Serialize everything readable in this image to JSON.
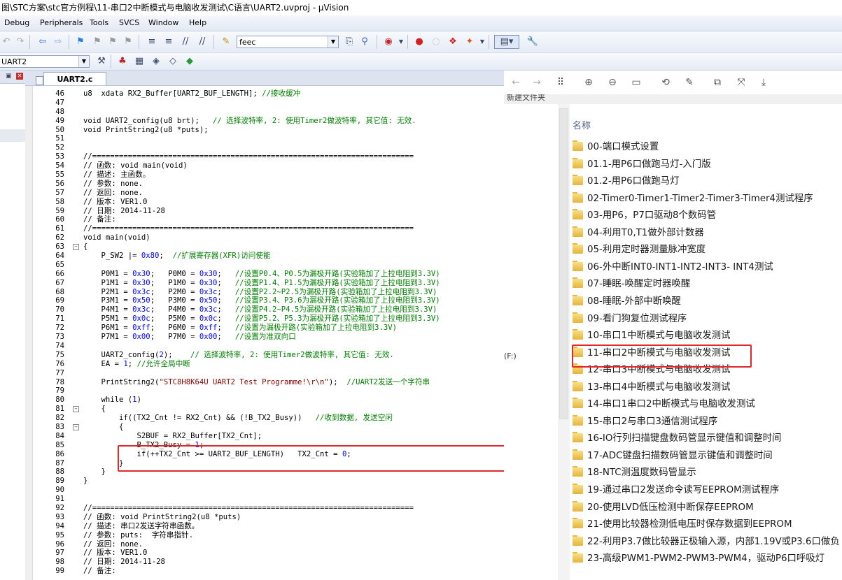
{
  "window": {
    "title": "图\\STC方案\\stc官方例程\\11-串口2中断模式与电脑收发测试\\C语言\\UART2.uvproj - µVision"
  },
  "menu": [
    "Debug",
    "Peripherals",
    "Tools",
    "SVCS",
    "Window",
    "Help"
  ],
  "toolbar": {
    "find_combo": "feec",
    "target_combo": "UART2"
  },
  "editor": {
    "tab_label": "UART2.c",
    "lines": [
      {
        "n": "46",
        "t": "u8  xdata RX2_Buffer[UART2_BUF_LENGTH]; //接收缓冲"
      },
      {
        "n": "47",
        "t": ""
      },
      {
        "n": "48",
        "t": ""
      },
      {
        "n": "49",
        "t": "void UART2_config(u8 brt);   // 选择波特率, 2: 使用Timer2做波特率, 其它值: 无效."
      },
      {
        "n": "50",
        "t": "void PrintString2(u8 *puts);"
      },
      {
        "n": "51",
        "t": ""
      },
      {
        "n": "52",
        "t": ""
      },
      {
        "n": "53",
        "t": "//========================================================================"
      },
      {
        "n": "54",
        "t": "// 函数: void main(void)"
      },
      {
        "n": "55",
        "t": "// 描述: 主函数。"
      },
      {
        "n": "56",
        "t": "// 参数: none."
      },
      {
        "n": "57",
        "t": "// 返回: none."
      },
      {
        "n": "58",
        "t": "// 版本: VER1.0"
      },
      {
        "n": "59",
        "t": "// 日期: 2014-11-28"
      },
      {
        "n": "60",
        "t": "// 备注:"
      },
      {
        "n": "61",
        "t": "//========================================================================"
      },
      {
        "n": "62",
        "t": "void main(void)"
      },
      {
        "n": "63",
        "t": "{"
      },
      {
        "n": "64",
        "t": "    P_SW2 |= 0x80;  //扩展寄存器(XFR)访问使能"
      },
      {
        "n": "65",
        "t": ""
      },
      {
        "n": "66",
        "t": "    P0M1 = 0x30;   P0M0 = 0x30;   //设置P0.4、P0.5为漏极开路(实验箱加了上拉电阻到3.3V)"
      },
      {
        "n": "67",
        "t": "    P1M1 = 0x30;   P1M0 = 0x30;   //设置P1.4、P1.5为漏极开路(实验箱加了上拉电阻到3.3V)"
      },
      {
        "n": "68",
        "t": "    P2M1 = 0x3c;   P2M0 = 0x3c;   //设置P2.2~P2.5为漏极开路(实验箱加了上拉电阻到3.3V)"
      },
      {
        "n": "69",
        "t": "    P3M1 = 0x50;   P3M0 = 0x50;   //设置P3.4、P3.6为漏极开路(实验箱加了上拉电阻到3.3V)"
      },
      {
        "n": "70",
        "t": "    P4M1 = 0x3c;   P4M0 = 0x3c;   //设置P4.2~P4.5为漏极开路(实验箱加了上拉电阻到3.3V)"
      },
      {
        "n": "71",
        "t": "    P5M1 = 0x0c;   P5M0 = 0x0c;   //设置P5.2、P5.3为漏极开路(实验箱加了上拉电阻到3.3V)"
      },
      {
        "n": "72",
        "t": "    P6M1 = 0xff;   P6M0 = 0xff;   //设置为漏极开路(实验箱加了上拉电阻到3.3V)"
      },
      {
        "n": "73",
        "t": "    P7M1 = 0x00;   P7M0 = 0x00;   //设置为准双向口"
      },
      {
        "n": "74",
        "t": ""
      },
      {
        "n": "75",
        "t": "    UART2_config(2);    // 选择波特率, 2: 使用Timer2做波特率, 其它值: 无效."
      },
      {
        "n": "76",
        "t": "    EA = 1; //允许全局中断"
      },
      {
        "n": "77",
        "t": ""
      },
      {
        "n": "78",
        "t": "    PrintString2(\"STC8H8K64U UART2 Test Programme!\\r\\n\");  //UART2发送一个字符串"
      },
      {
        "n": "79",
        "t": ""
      },
      {
        "n": "80",
        "t": "    while (1)"
      },
      {
        "n": "81",
        "t": "    {"
      },
      {
        "n": "82",
        "t": "        if((TX2_Cnt != RX2_Cnt) && (!B_TX2_Busy))   //收到数据, 发送空闲"
      },
      {
        "n": "83",
        "t": "        {"
      },
      {
        "n": "84",
        "t": "            S2BUF = RX2_Buffer[TX2_Cnt];"
      },
      {
        "n": "85",
        "t": "            B_TX2_Busy = 1;"
      },
      {
        "n": "86",
        "t": "            if(++TX2_Cnt >= UART2_BUF_LENGTH)   TX2_Cnt = 0;"
      },
      {
        "n": "87",
        "t": "        }"
      },
      {
        "n": "88",
        "t": "    }"
      },
      {
        "n": "89",
        "t": "}"
      },
      {
        "n": "90",
        "t": ""
      },
      {
        "n": "91",
        "t": ""
      },
      {
        "n": "92",
        "t": "//========================================================================"
      },
      {
        "n": "93",
        "t": "// 函数: void PrintString2(u8 *puts)"
      },
      {
        "n": "94",
        "t": "// 描述: 串口2发送字符串函数。"
      },
      {
        "n": "95",
        "t": "// 参数: puts:  字符串指针."
      },
      {
        "n": "96",
        "t": "// 返回: none."
      },
      {
        "n": "97",
        "t": "// 版本: VER1.0"
      },
      {
        "n": "98",
        "t": "// 日期: 2014-11-28"
      },
      {
        "n": "99",
        "t": "// 备注:"
      }
    ]
  },
  "explorer": {
    "breadcrumb": "新建文件夹",
    "drive_label": "(F:)",
    "column_header": "名称",
    "folders": [
      "00-端口模式设置",
      "01.1-用P6口做跑马灯-入门版",
      "01.2-用P6口做跑马灯",
      "02-Timer0-Timer1-Timer2-Timer3-Timer4测试程序",
      "03-用P6，P7口驱动8个数码管",
      "04-利用T0,T1做外部计数器",
      "05-利用定时器测量脉冲宽度",
      "06-外中断INT0-INT1-INT2-INT3- INT4测试",
      "07-睡眠-唤醒定时器唤醒",
      "08-睡眠-外部中断唤醒",
      "09-看门狗复位测试程序",
      "10-串口1中断模式与电脑收发测试",
      "11-串口2中断模式与电脑收发测试",
      "12-串口3中断模式与电脑收发测试",
      "13-串口4中断模式与电脑收发测试",
      "14-串口1串口2中断模式与电脑收发测试",
      "15-串口2与串口3通信测试程序",
      "16-IO行列扫描键盘数码管显示键值和调整时间",
      "17-ADC键盘扫描数码管显示键值和调整时间",
      "18-NTC测温度数码管显示",
      "19-通过串口2发送命令读写EEPROM测试程序",
      "20-使用LVD低压检测中断保存EEPROM",
      "21-使用比较器检测低电压时保存数据到EEPROM",
      "22-利用P3.7做比较器正极输入源，内部1.19V或P3.6口做负",
      "23-高级PWM1-PWM2-PWM3-PWM4，驱动P6口呼吸灯"
    ]
  },
  "colors": {
    "highlight_border": "#e0282b",
    "comment": "#007f00",
    "number": "#0000ff"
  }
}
